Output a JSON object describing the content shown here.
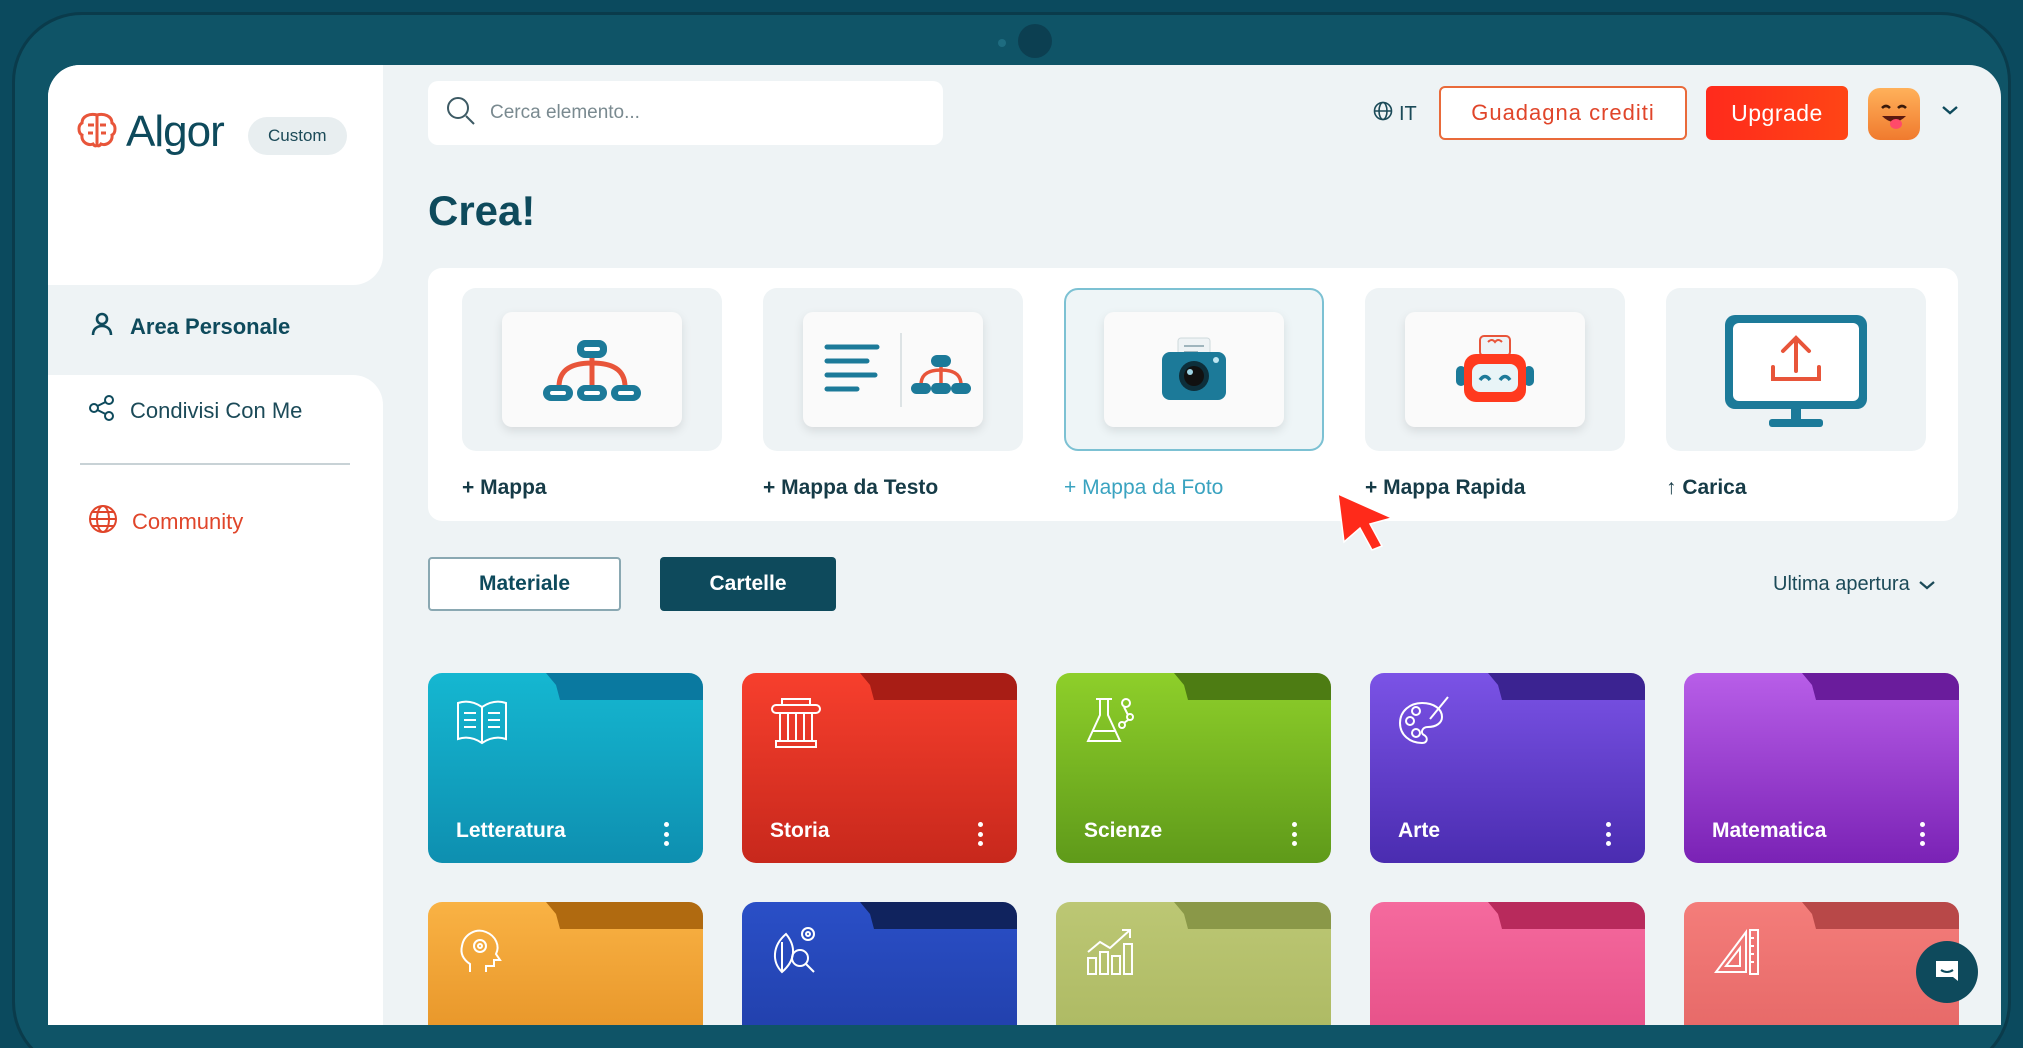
{
  "app": {
    "logo_text": "Algor",
    "plan_badge": "Custom"
  },
  "sidebar": {
    "items": [
      {
        "label": "Area Personale",
        "icon": "user-icon",
        "active": true,
        "color": "#0e4a5c"
      },
      {
        "label": "Condivisi Con Me",
        "icon": "share-icon",
        "active": false,
        "color": "#1b4a58"
      },
      {
        "label": "Community",
        "icon": "globe-icon",
        "active": false,
        "color": "#e0452a"
      }
    ]
  },
  "header": {
    "search_placeholder": "Cerca elemento...",
    "language": "IT",
    "earn_credits": "Guadagna crediti",
    "upgrade": "Upgrade"
  },
  "main": {
    "title": "Crea!",
    "create_options": [
      {
        "label": "+ Mappa",
        "icon": "mind-map-icon",
        "selected": false
      },
      {
        "label": "+ Mappa da Testo",
        "icon": "text-to-map-icon",
        "selected": false
      },
      {
        "label": "+ Mappa da Foto",
        "icon": "camera-icon",
        "selected": true
      },
      {
        "label": "+ Mappa Rapida",
        "icon": "robot-icon",
        "selected": false
      },
      {
        "label": "↑ Carica",
        "icon": "upload-monitor-icon",
        "selected": false
      }
    ],
    "tabs": [
      {
        "label": "Materiale",
        "active": false
      },
      {
        "label": "Cartelle",
        "active": true
      }
    ],
    "sort_label": "Ultima apertura",
    "folders": [
      {
        "name": "Letteratura",
        "icon": "book-icon",
        "color_top": "#15b7d1",
        "color_bottom": "#0e8fb0",
        "tab_color": "#0a79a0"
      },
      {
        "name": "Storia",
        "icon": "column-icon",
        "color_top": "#f73f2d",
        "color_bottom": "#c7281c",
        "tab_color": "#a81d15"
      },
      {
        "name": "Scienze",
        "icon": "flask-icon",
        "color_top": "#8ecf2a",
        "color_bottom": "#5f9a1a",
        "tab_color": "#4d7c13"
      },
      {
        "name": "Arte",
        "icon": "palette-icon",
        "color_top": "#7b53e6",
        "color_bottom": "#4a2cb0",
        "tab_color": "#3b2391"
      },
      {
        "name": "Matematica",
        "icon": "",
        "color_top": "#b85ee8",
        "color_bottom": "#7a22b5",
        "tab_color": "#6a1c9c"
      },
      {
        "name": "",
        "icon": "head-gears-icon",
        "color_top": "#f9b244",
        "color_bottom": "#e08a1e",
        "tab_color": "#b06a10"
      },
      {
        "name": "",
        "icon": "leaf-search-icon",
        "color_top": "#2a4fc7",
        "color_bottom": "#1e3aa0",
        "tab_color": "#10235e"
      },
      {
        "name": "",
        "icon": "growth-chart-icon",
        "color_top": "#bcc774",
        "color_bottom": "#a7b45c",
        "tab_color": "#8a9848"
      },
      {
        "name": "",
        "icon": "",
        "color_top": "#f56a9e",
        "color_bottom": "#e0467f",
        "tab_color": "#b82a5c"
      },
      {
        "name": "",
        "icon": "set-square-icon",
        "color_top": "#f47d7a",
        "color_bottom": "#e06060",
        "tab_color": "#b84848"
      }
    ]
  }
}
